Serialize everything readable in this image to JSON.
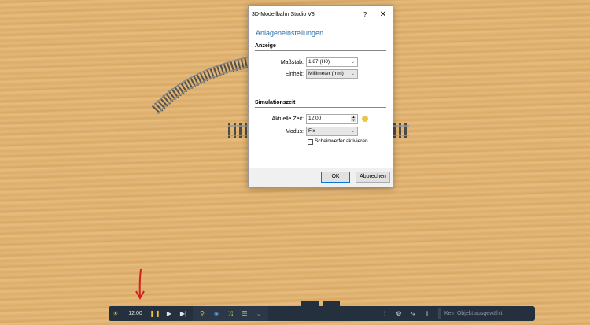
{
  "dialog": {
    "title": "3D-Modellbahn Studio V8",
    "help": "?",
    "close": "✕",
    "heading": "Anlageneinstellungen",
    "display_section": "Anzeige",
    "scale_label": "Maßstab:",
    "scale_value": "1:87 (H0)",
    "unit_label": "Einheit:",
    "unit_value": "Millimeter (mm)",
    "sim_section": "Simulationszeit",
    "time_label": "Aktuelle Zeit:",
    "time_value": "12:00",
    "mode_label": "Modus:",
    "mode_value": "Fix",
    "headlights_label": "Scheinwerfer aktivieren",
    "headlights_checked": false,
    "ok": "OK",
    "cancel": "Abbrechen"
  },
  "toolbar": {
    "time": "12:00",
    "status": "Kein Objekt ausgewählt"
  },
  "colors": {
    "toolbar": "#25303e",
    "accent": "#2b6ea8",
    "arrow": "#d42020"
  }
}
